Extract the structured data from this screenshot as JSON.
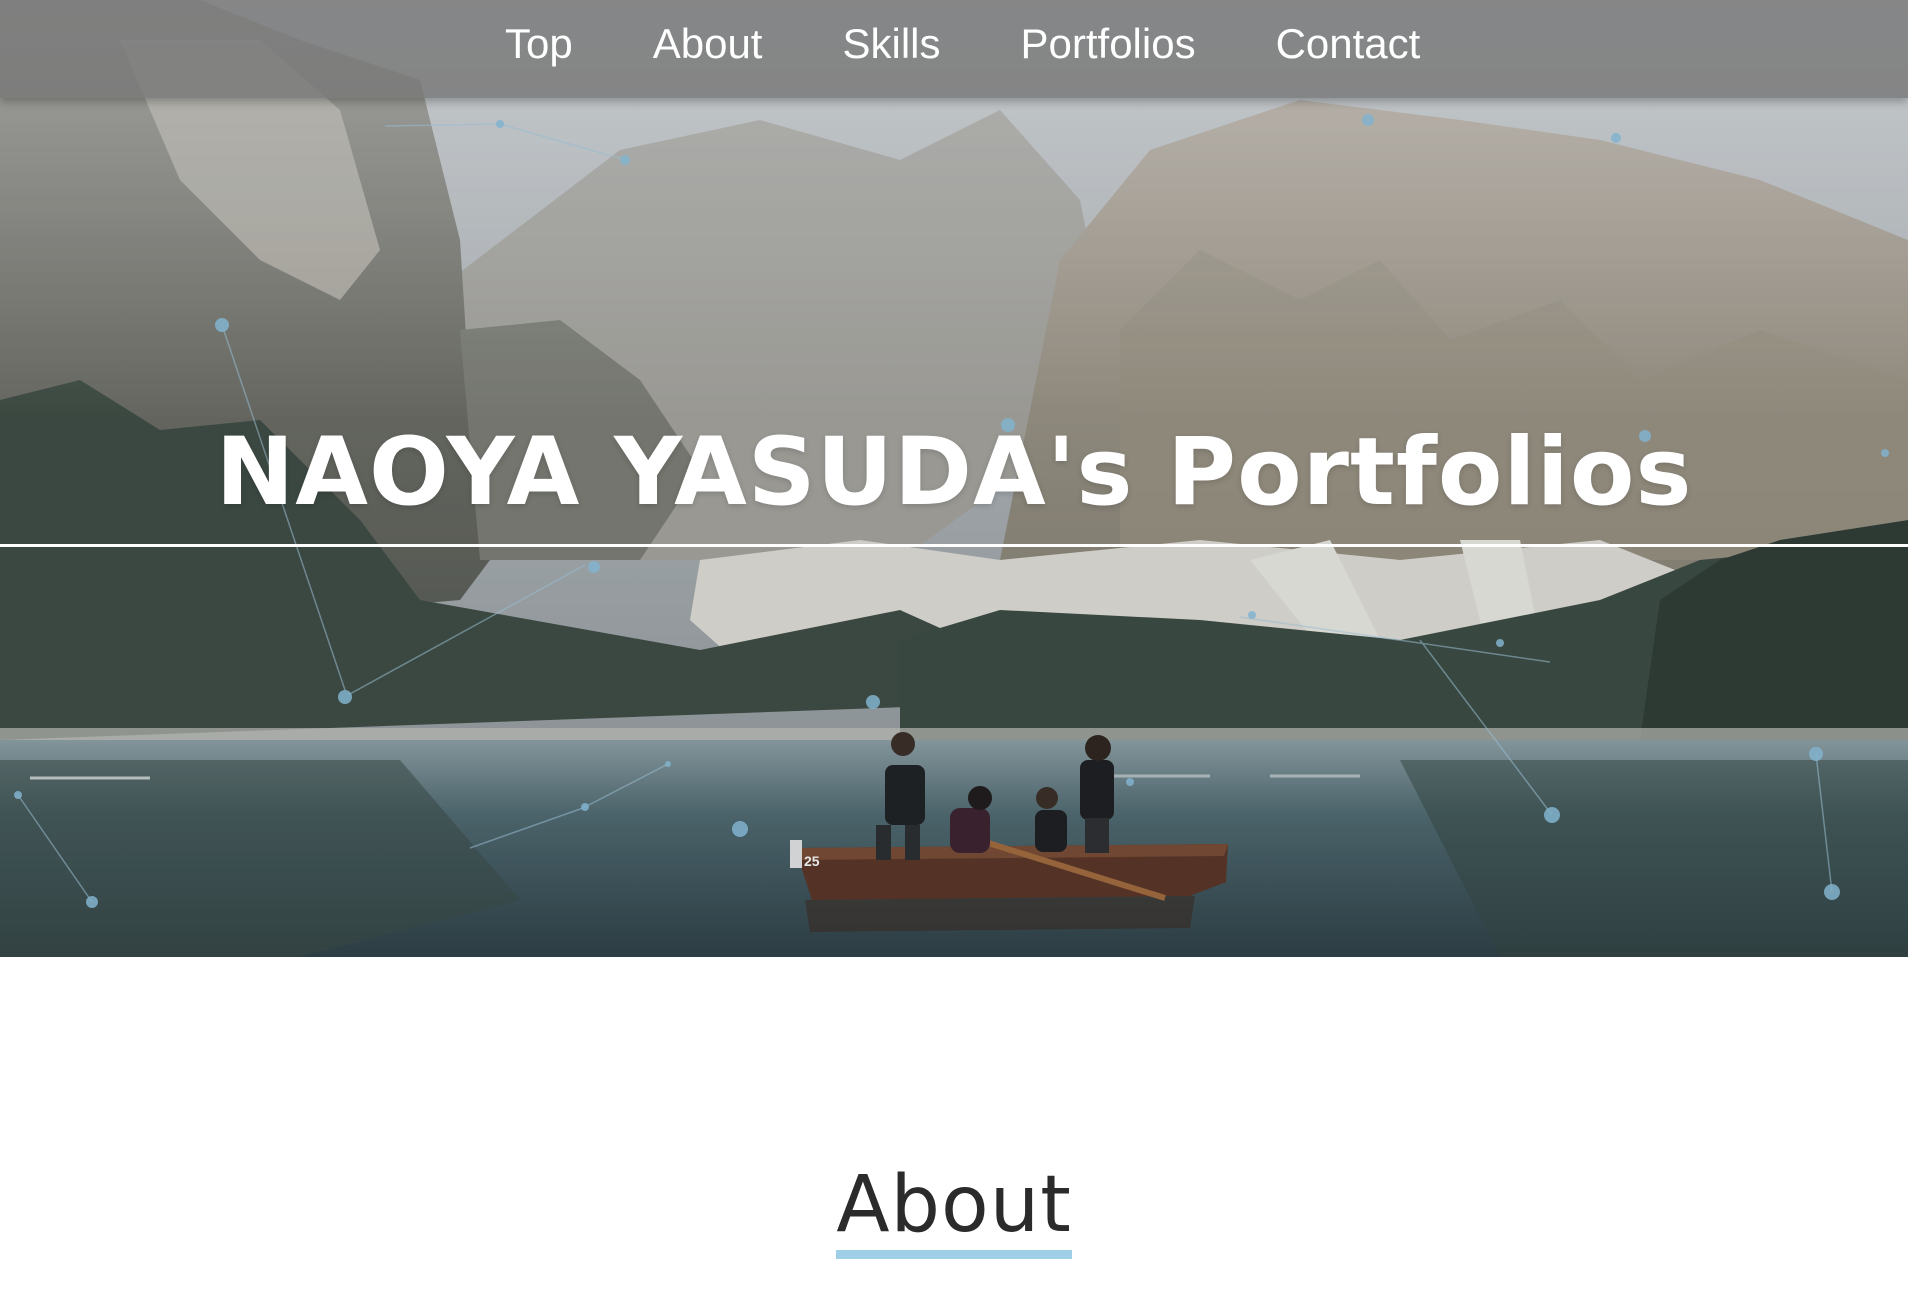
{
  "nav": {
    "items": [
      {
        "label": "Top"
      },
      {
        "label": "About"
      },
      {
        "label": "Skills"
      },
      {
        "label": "Portfolios"
      },
      {
        "label": "Contact"
      }
    ]
  },
  "hero": {
    "title": "NAOYA YASUDA's Portfolios",
    "boat_number": "25",
    "image_desc_icon": "mountain-lake-boat-photo"
  },
  "about": {
    "heading": "About",
    "accent_color": "#9fcfe6"
  },
  "colors": {
    "nav_bg": "#787878",
    "text_white": "#ffffff",
    "heading_dark": "#2b2b2b"
  }
}
